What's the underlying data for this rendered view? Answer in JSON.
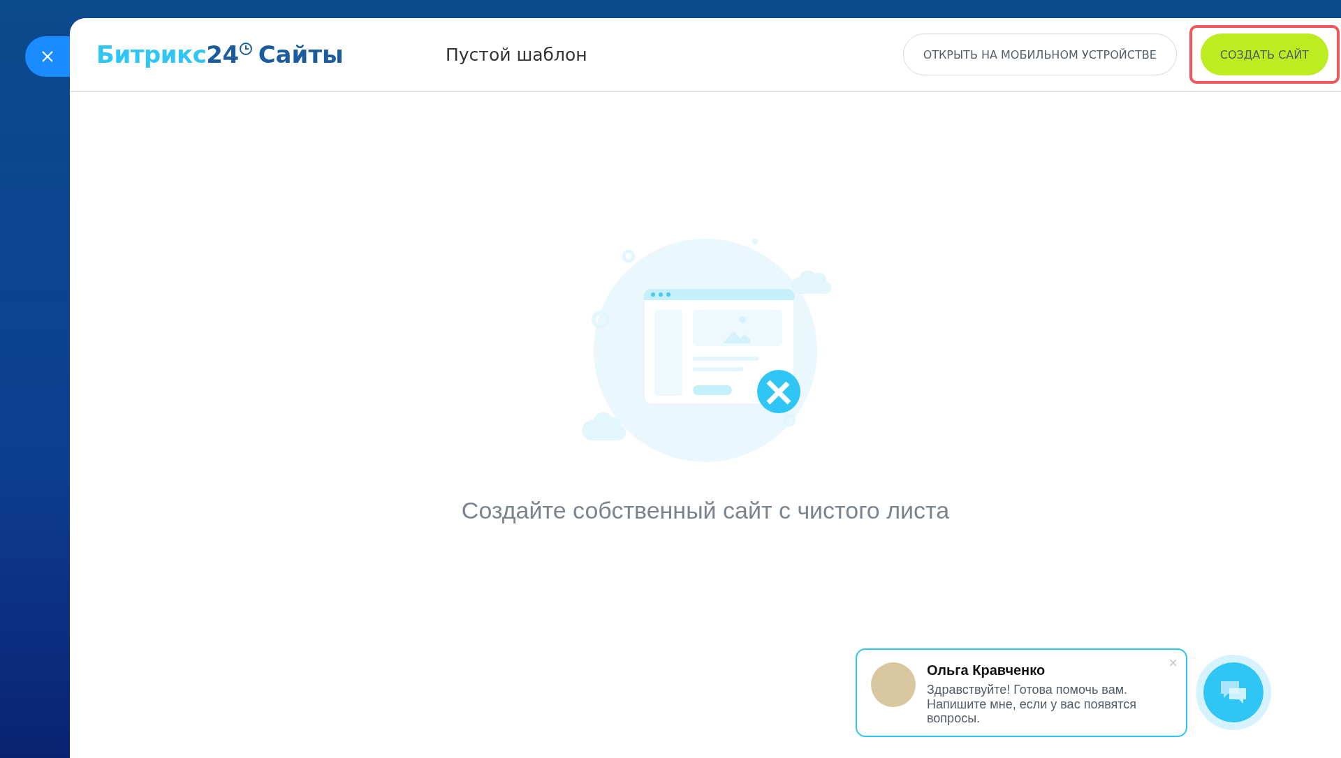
{
  "header": {
    "logo": {
      "brand": "Битрикс",
      "number": "24",
      "product": "Сайты"
    },
    "title": "Пустой шаблон",
    "buttons": [
      {
        "kind": "outline",
        "label": "ОТКРЫТЬ НА МОБИЛЬНОМ УСТРОЙСТВЕ",
        "highlighted": false
      },
      {
        "kind": "primary",
        "label": "СОЗДАТЬ САЙТ",
        "highlighted": true
      }
    ]
  },
  "empty_state": {
    "caption": "Создайте собственный сайт с чистого листа"
  },
  "chat": {
    "name": "Ольга Кравченко",
    "message": "Здравствуйте! Готова помочь вам. Напишите мне, если у вас появятся вопросы.",
    "close": "×"
  }
}
